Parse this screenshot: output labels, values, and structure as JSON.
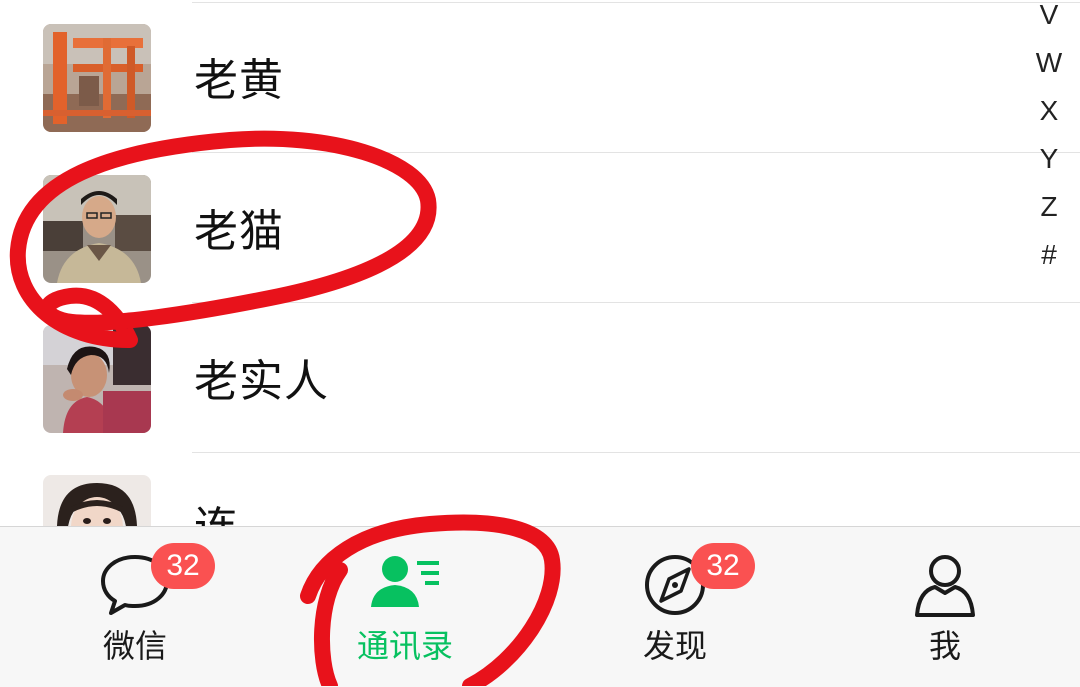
{
  "contacts": [
    {
      "name": "老黄",
      "avatar": "construction-site-photo"
    },
    {
      "name": "老猫",
      "avatar": "man-portrait-photo"
    },
    {
      "name": "老实人",
      "avatar": "man-leaning-photo"
    },
    {
      "name": "连",
      "avatar": "woman-portrait-photo"
    }
  ],
  "index_bar": [
    "V",
    "W",
    "X",
    "Y",
    "Z",
    "#"
  ],
  "tabs": [
    {
      "label": "微信",
      "icon": "chat-bubble-icon",
      "badge": "32",
      "active": false
    },
    {
      "label": "通讯录",
      "icon": "contacts-icon",
      "badge": "",
      "active": true
    },
    {
      "label": "发现",
      "icon": "compass-icon",
      "badge": "32",
      "active": false
    },
    {
      "label": "我",
      "icon": "person-outline-icon",
      "badge": "",
      "active": false
    }
  ],
  "colors": {
    "accent": "#07c160",
    "badge": "#fa5151",
    "annotation": "#e8121b",
    "tabbar_bg": "#f7f7f7"
  }
}
